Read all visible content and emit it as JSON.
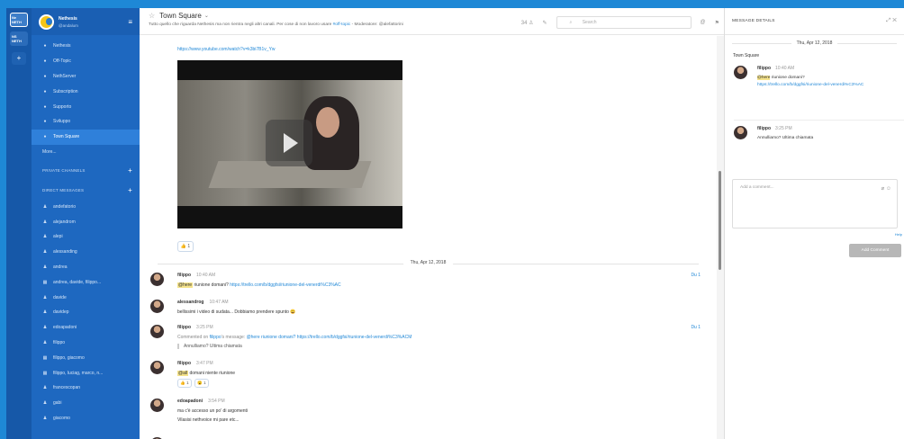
{
  "teams": [
    {
      "label": "Ne\nNETH"
    },
    {
      "label": "NS\nNETH"
    }
  ],
  "team_add": "+",
  "sidebar": {
    "team_name": "Nethesis",
    "username": "@andalum",
    "channels": [
      {
        "label": "Nethesis",
        "icon": "●"
      },
      {
        "label": "Off-Topic",
        "icon": "●"
      },
      {
        "label": "NethServer",
        "icon": "●"
      },
      {
        "label": "Subscription",
        "icon": "●"
      },
      {
        "label": "Supporto",
        "icon": "●"
      },
      {
        "label": "Sviluppo",
        "icon": "●"
      },
      {
        "label": "Town Square",
        "icon": "●"
      }
    ],
    "more": "More...",
    "private_channels": "PRIVATE CHANNELS",
    "direct_messages": "DIRECT MESSAGES",
    "dms": [
      {
        "label": "andefatorio",
        "icon": "♟"
      },
      {
        "label": "alejandrom",
        "icon": "♟"
      },
      {
        "label": "alepi",
        "icon": "♟"
      },
      {
        "label": "alessanding",
        "icon": "♟"
      },
      {
        "label": "andrea",
        "icon": "♟"
      },
      {
        "label": "andrea, davide, filippo...",
        "icon": "▦"
      },
      {
        "label": "davide",
        "icon": "♟"
      },
      {
        "label": "davidep",
        "icon": "♟"
      },
      {
        "label": "edoapadoni",
        "icon": "♟"
      },
      {
        "label": "filippo",
        "icon": "♟"
      },
      {
        "label": "filippo, giacomo",
        "icon": "▦"
      },
      {
        "label": "filippo, luciag, marco, n...",
        "icon": "▦"
      },
      {
        "label": "francescopan",
        "icon": "♟"
      },
      {
        "label": "gabi",
        "icon": "♟"
      },
      {
        "label": "giacomo",
        "icon": "♟"
      }
    ]
  },
  "channel": {
    "name": "Town Square",
    "purpose": "Tutto quello che riguarda Nethesis ma non rientra negli altri canali. Per cose di non lavoro usare",
    "purpose_tag": "#off-topic",
    "purpose_tail": " - Moderatore: @alefattorini",
    "member_count": "34 ♙",
    "search_placeholder": "Search"
  },
  "posts_area": {
    "top_link": "https://www.youtube.com/watch?v=k3bi7B1v_Yw",
    "top_reaction": "👍 1",
    "date_separator": "Thu, Apr 12, 2018"
  },
  "posts": [
    {
      "author": "filippo",
      "time": "10:40 AM",
      "mention": "@here",
      "text": " riunione domani? ",
      "link": "https://trello.com/b/dggfsi/riunione-del-venerdi%C3%AC",
      "reply": "Du 1"
    },
    {
      "author": "alessandrog",
      "time": "10:47 AM",
      "text": "bellissimi i video di sudata... Dobbiamo prendere spunto 😄"
    },
    {
      "author": "filippo",
      "time": "3:25 PM",
      "prefix": "Commented on ",
      "prefix_user": "filippo",
      "prefix_tail": "'s message: ",
      "link": "@here riunione domani? https://trello.com/b/dggfsi/riunione-del-venerdi%C3%ACM",
      "quote": "Annulliamo? Ultima chiamata",
      "reply": "Du 1"
    },
    {
      "author": "filippo",
      "time": "3:47 PM",
      "mention": "@all",
      "text": " domani niente riunione",
      "reacts": [
        "👍 1",
        "😮 1"
      ]
    },
    {
      "author": "edoapadoni",
      "time": "3:54 PM",
      "text": "ma c'è accesso un po' di argomenti",
      "text2": "Vilasisi nethvoice mi pare etc..."
    }
  ],
  "rhs": {
    "title": "MESSAGE DETAILS",
    "date": "Thu, Apr 12, 2018",
    "channel": "Town Square",
    "root": {
      "author": "filippo",
      "time": "10:40 AM",
      "mention": "@here",
      "text": " riunione domani?",
      "link": "https://trello.com/b/dggfsi/riunione-del-venerdi%C3%AC"
    },
    "reply": {
      "author": "filippo",
      "time": "3:25 PM",
      "text": "Annulliamo? Ultima chiamata"
    },
    "comment_placeholder": "Add a comment...",
    "help": "Help",
    "add_comment": "Add Comment"
  }
}
